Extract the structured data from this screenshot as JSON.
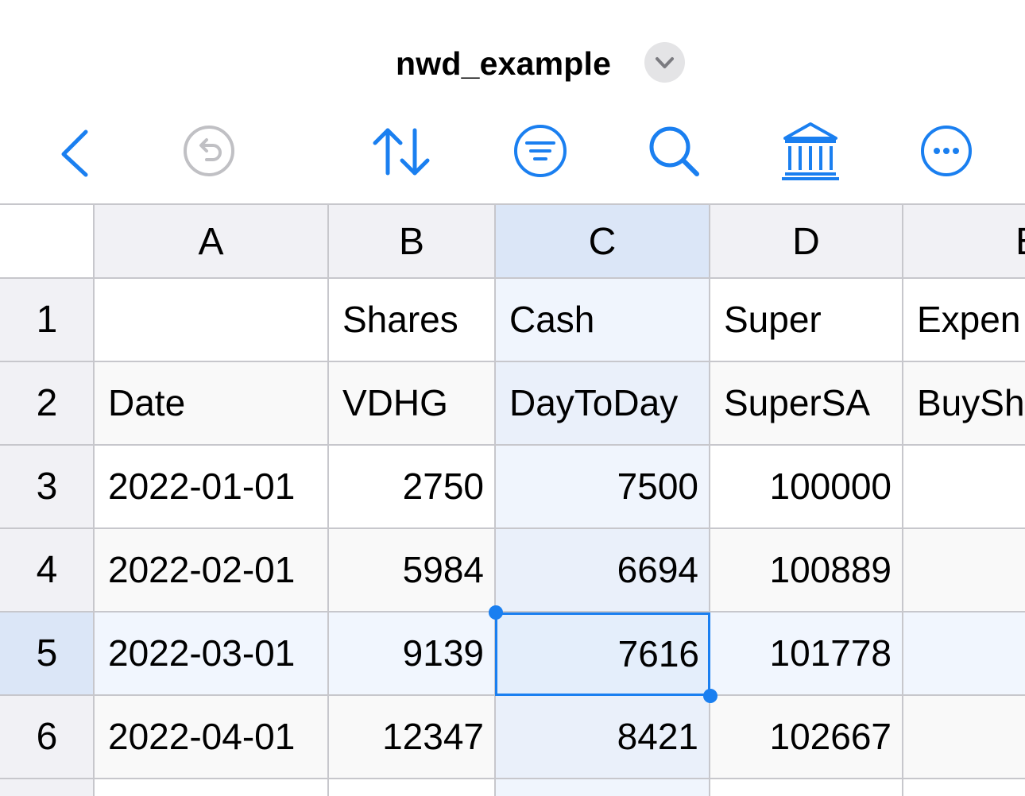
{
  "document": {
    "title": "nwd_example"
  },
  "colors": {
    "accent": "#1a7ff0",
    "disabled": "#c0c0c4",
    "header_bg": "#f1f1f5",
    "selected_header_bg": "#dbe6f7"
  },
  "toolbar": {
    "items": [
      {
        "name": "back",
        "icon": "chevron-left-icon"
      },
      {
        "name": "undo",
        "icon": "undo-circle-icon",
        "disabled": true
      },
      {
        "name": "sort",
        "icon": "sort-arrows-icon"
      },
      {
        "name": "filter",
        "icon": "filter-circle-icon"
      },
      {
        "name": "search",
        "icon": "magnifier-icon"
      },
      {
        "name": "database",
        "icon": "bank-columns-icon"
      },
      {
        "name": "more",
        "icon": "ellipsis-circle-icon"
      }
    ]
  },
  "sheet": {
    "columns": [
      "A",
      "B",
      "C",
      "D",
      "E"
    ],
    "rows": [
      "1",
      "2",
      "3",
      "4",
      "5",
      "6"
    ],
    "cells": [
      [
        "",
        "Shares",
        "Cash",
        "Super",
        "Expen"
      ],
      [
        "Date",
        "VDHG",
        "DayToDay",
        "SuperSA",
        "BuySh"
      ],
      [
        "2022-01-01",
        "2750",
        "7500",
        "100000",
        ""
      ],
      [
        "2022-02-01",
        "5984",
        "6694",
        "100889",
        ""
      ],
      [
        "2022-03-01",
        "9139",
        "7616",
        "101778",
        ""
      ],
      [
        "2022-04-01",
        "12347",
        "8421",
        "102667",
        ""
      ]
    ],
    "selected": {
      "column": "C",
      "row": "5"
    }
  }
}
